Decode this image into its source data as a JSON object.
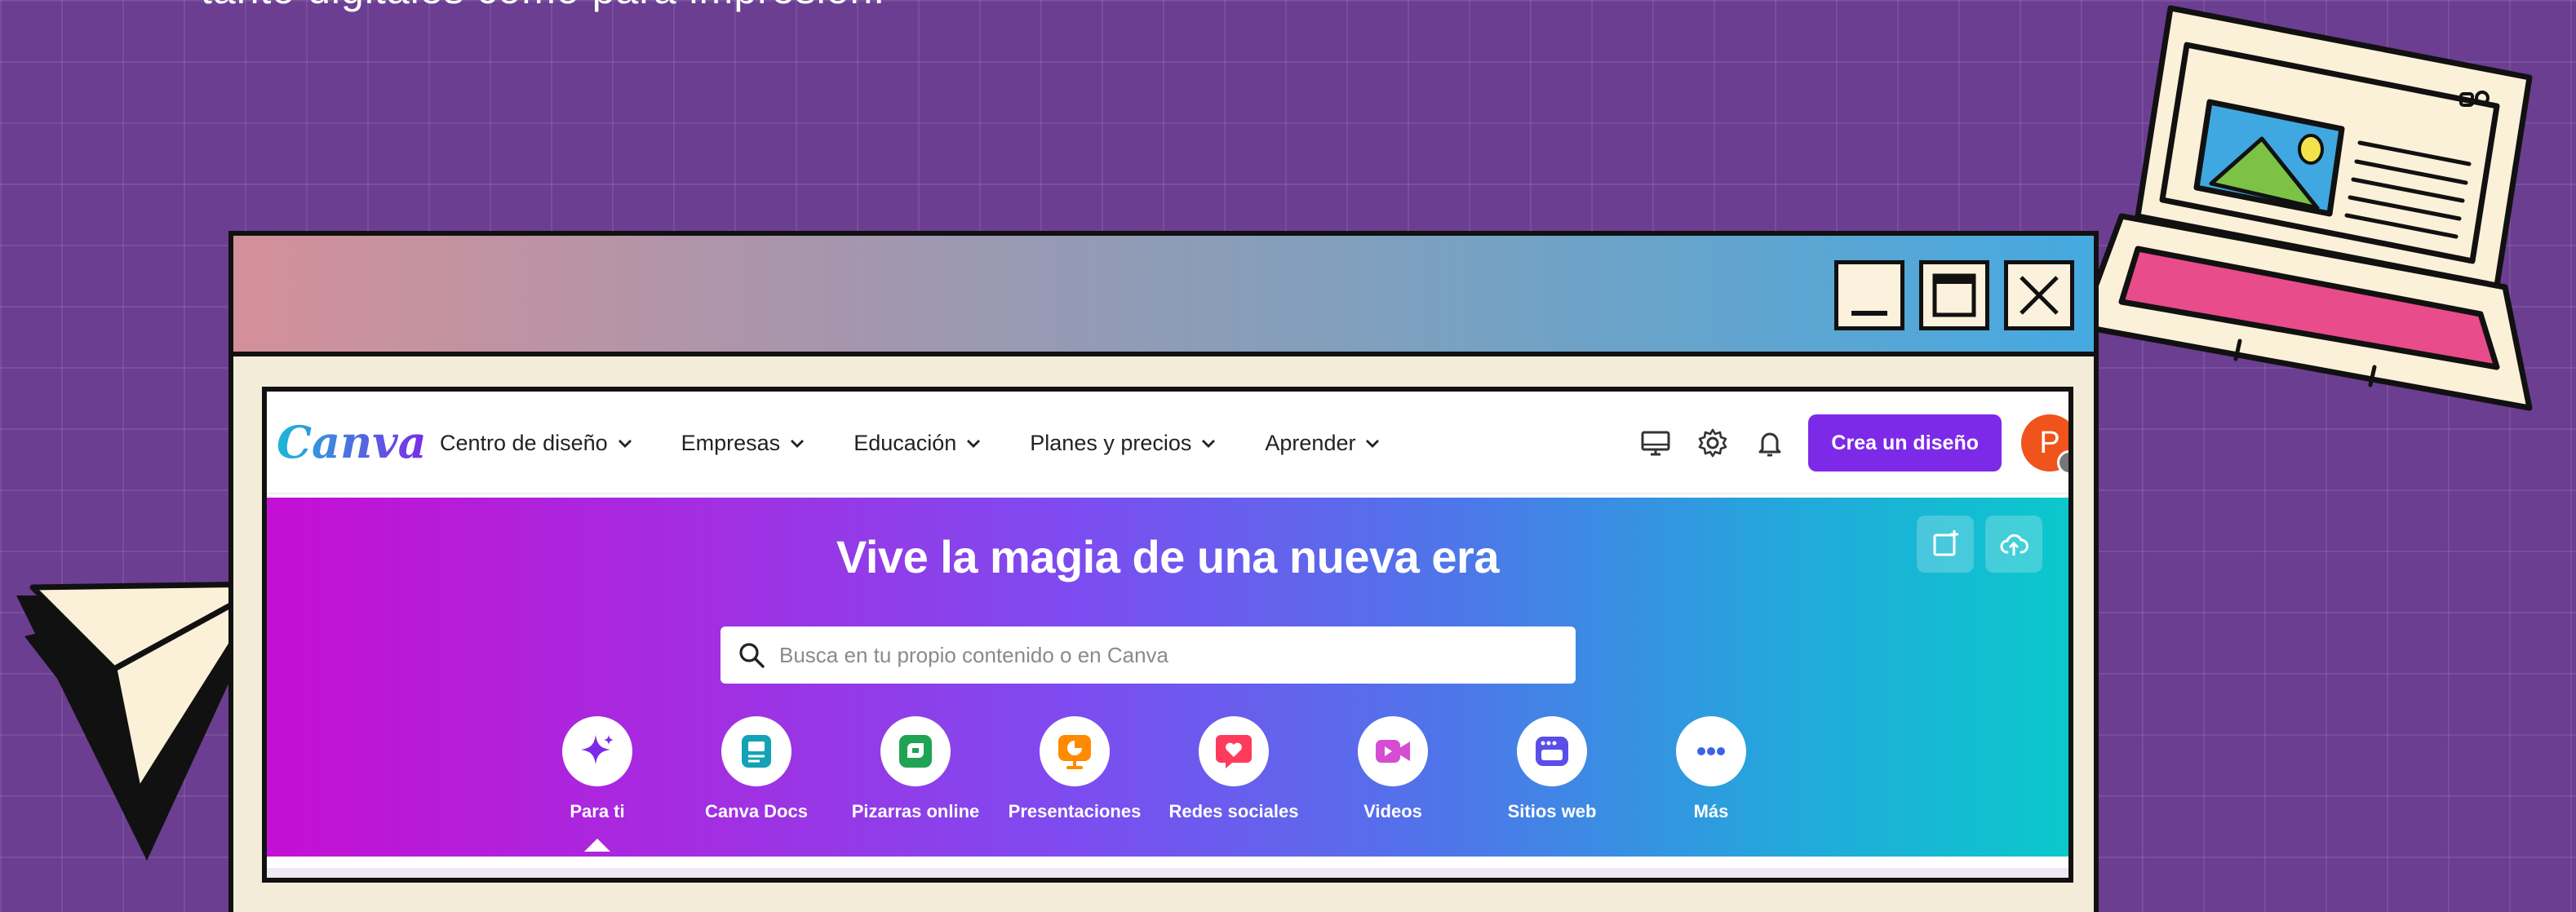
{
  "intro": {
    "text": "tanto digitales como para impresión."
  },
  "window_controls": {
    "minimize": "minimize",
    "maximize": "maximize",
    "close": "close"
  },
  "app": {
    "logo": "Canva",
    "nav": {
      "items": [
        {
          "label": "Centro de diseño"
        },
        {
          "label": "Empresas"
        },
        {
          "label": "Educación"
        },
        {
          "label": "Planes y precios"
        },
        {
          "label": "Aprender"
        }
      ],
      "icons": [
        "desktop-icon",
        "settings-icon",
        "notifications-icon"
      ],
      "cta_label": "Crea un diseño",
      "avatar_initial": "P"
    },
    "hero": {
      "title": "Vive la magia de una nueva era",
      "search_placeholder": "Busca en tu propio contenido o en Canva",
      "actions": [
        "custom-size-icon",
        "upload-icon"
      ],
      "categories": [
        {
          "label": "Para ti",
          "icon": "sparkle-icon",
          "color": "#7d2ae8",
          "active": true
        },
        {
          "label": "Canva Docs",
          "icon": "docs-icon",
          "color": "#13a3b5"
        },
        {
          "label": "Pizarras online",
          "icon": "whiteboard-icon",
          "color": "#1fa355"
        },
        {
          "label": "Presentaciones",
          "icon": "presentation-icon",
          "color": "#ff8a00"
        },
        {
          "label": "Redes sociales",
          "icon": "social-heart-icon",
          "color": "#ff3b5c"
        },
        {
          "label": "Videos",
          "icon": "video-icon",
          "color": "#d64dd4"
        },
        {
          "label": "Sitios web",
          "icon": "website-icon",
          "color": "#5b4ee8"
        },
        {
          "label": "Más",
          "icon": "more-icon",
          "color": "#3d63e8"
        }
      ]
    }
  },
  "colors": {
    "background": "#6b3e91",
    "cta": "#7d2ae8",
    "window_frame": "#f3ecd9"
  }
}
